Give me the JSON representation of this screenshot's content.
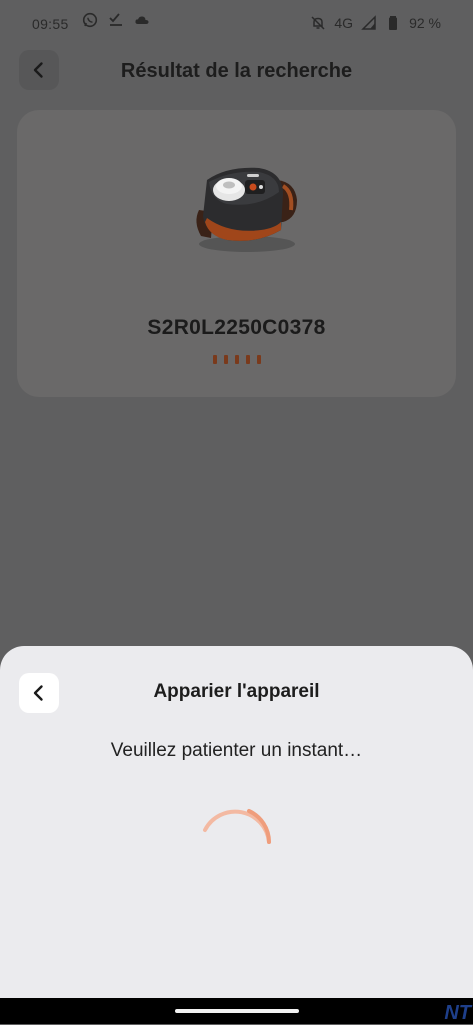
{
  "status_bar": {
    "time": "09:55",
    "network": "4G",
    "battery": "92 %",
    "left_icons": [
      "whatsapp-icon",
      "task-check-icon",
      "cloud-icon"
    ],
    "right_icons": [
      "notifications-off-icon",
      "signal-icon",
      "battery-icon"
    ]
  },
  "header": {
    "title": "Résultat de la recherche",
    "back_icon": "chevron-left-icon"
  },
  "result": {
    "device_id": "S2R0L2250C0378",
    "indicator_dots": 5,
    "accent_color": "#7a3a1c"
  },
  "sheet": {
    "title": "Apparier l'appareil",
    "message": "Veuillez patienter un instant…",
    "back_icon": "chevron-left-icon",
    "spinner_color": "#f0a488"
  },
  "watermark": "NT"
}
